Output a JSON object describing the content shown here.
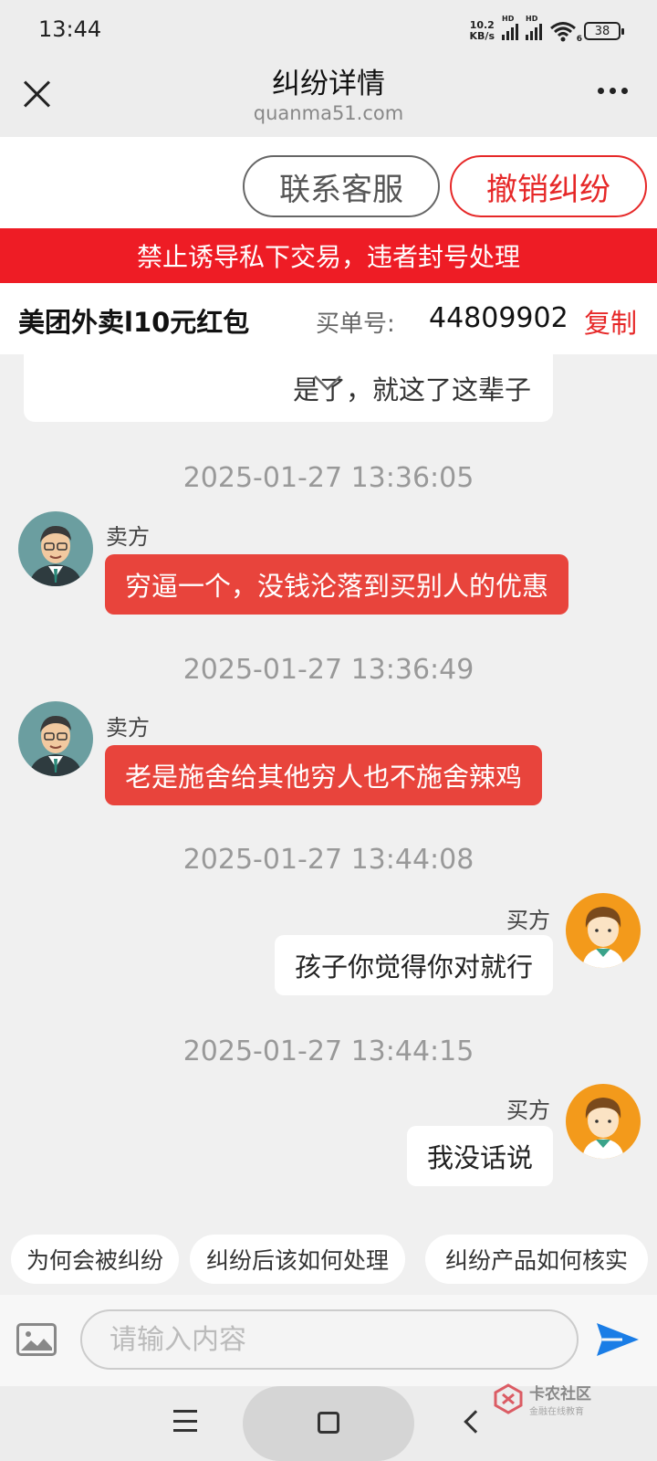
{
  "status_bar": {
    "time": "13:44",
    "net_speed_value": "10.2",
    "net_speed_unit": "KB/s",
    "signal_label_1": "HD",
    "signal_label_2": "HD",
    "wifi_label": "6",
    "battery": "38"
  },
  "header": {
    "title": "纠纷详情",
    "domain": "quanma51.com"
  },
  "actions": {
    "contact_label": "联系客服",
    "cancel_label": "撤销纠纷"
  },
  "warning": "禁止诱导私下交易，违者封号处理",
  "order": {
    "product": "美团外卖l10元红包",
    "number_label": "买单号:",
    "number": "44809902",
    "copy_label": "复制"
  },
  "previous_message_tail": "是了，就这了这辈子",
  "messages": [
    {
      "timestamp": "2025-01-27 13:36:05",
      "sender": "卖方",
      "role": "seller",
      "text": "穷逼一个，没钱沦落到买别人的优惠"
    },
    {
      "timestamp": "2025-01-27 13:36:49",
      "sender": "卖方",
      "role": "seller",
      "text": "老是施舍给其他穷人也不施舍辣鸡"
    },
    {
      "timestamp": "2025-01-27 13:44:08",
      "sender": "买方",
      "role": "buyer",
      "text": "孩子你觉得你对就行"
    },
    {
      "timestamp": "2025-01-27 13:44:15",
      "sender": "买方",
      "role": "buyer",
      "text": "我没话说"
    }
  ],
  "quick_questions": [
    "为何会被纠纷",
    "纠纷后该如何处理",
    "纠纷产品如何核实"
  ],
  "input": {
    "placeholder": "请输入内容"
  },
  "watermark": {
    "title": "卡农社区",
    "subtitle": "金融在线教育"
  },
  "colors": {
    "accent_red": "#e62828",
    "banner_red": "#ee1c25",
    "seller_bubble": "#e8443c"
  }
}
